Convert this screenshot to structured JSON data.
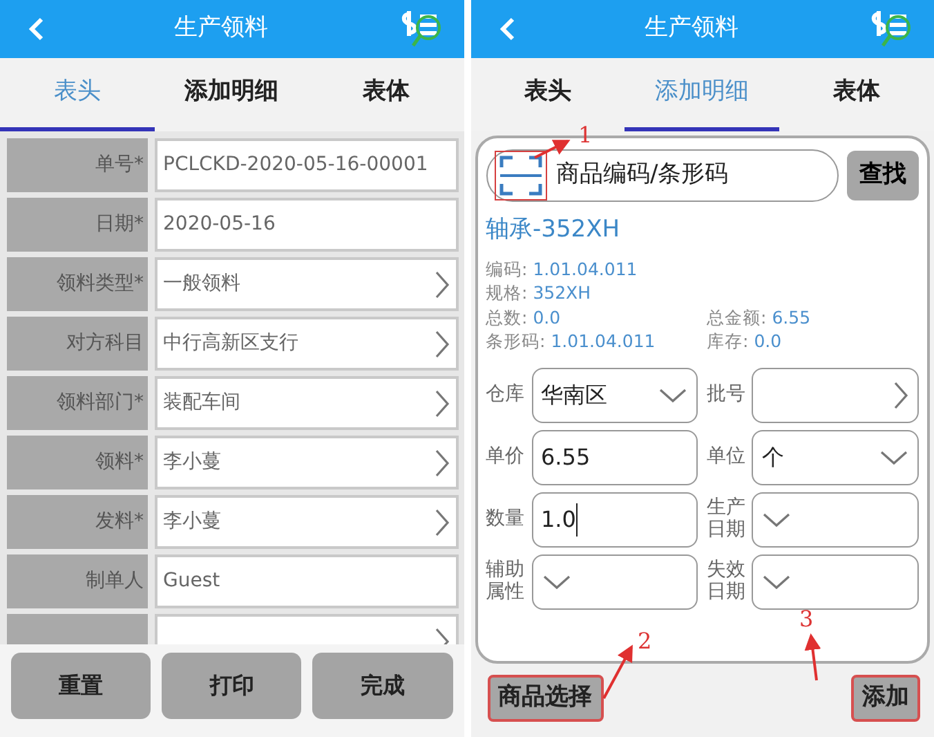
{
  "screens": [
    {
      "title": "生产领料",
      "tabs": [
        {
          "label": "表头",
          "selected": true
        },
        {
          "label": "添加明细",
          "selected": false
        },
        {
          "label": "表体",
          "selected": false
        }
      ],
      "fields": [
        {
          "label": "单号*",
          "value": "PCLCKD-2020-05-16-00001",
          "kind": "text"
        },
        {
          "label": "日期*",
          "value": "2020-05-16",
          "kind": "text"
        },
        {
          "label": "领料类型*",
          "value": "一般领料",
          "kind": "picker"
        },
        {
          "label": "对方科目",
          "value": "中行高新区支行",
          "kind": "picker"
        },
        {
          "label": "领料部门*",
          "value": "装配车间",
          "kind": "picker"
        },
        {
          "label": "领料*",
          "value": "李小蔓",
          "kind": "picker"
        },
        {
          "label": "发料*",
          "value": "李小蔓",
          "kind": "picker"
        },
        {
          "label": "制单人",
          "value": "Guest",
          "kind": "text"
        },
        {
          "kind": "picker"
        }
      ],
      "buttons": [
        "重置",
        "打印",
        "完成"
      ]
    },
    {
      "title": "生产领料",
      "tabs": [
        {
          "label": "表头",
          "selected": false
        },
        {
          "label": "添加明细",
          "selected": true
        },
        {
          "label": "表体",
          "selected": false
        }
      ],
      "search": {
        "placeholder": "商品编码/条形码",
        "button": "查找"
      },
      "product": {
        "name": "轴承-352XH",
        "spec_rows": [
          [
            {
              "label": "编码:",
              "value": "1.01.04.011"
            }
          ],
          [
            {
              "label": "规格:",
              "value": "352XH"
            }
          ],
          [
            {
              "label": "总数:",
              "value": "0.0"
            },
            {
              "label": "总金额:",
              "value": "6.55"
            }
          ],
          [
            {
              "label": "条形码:",
              "value": "1.01.04.011"
            },
            {
              "label": "库存:",
              "value": "0.0"
            }
          ]
        ]
      },
      "form": [
        [
          {
            "label": "仓库",
            "value": "华南区",
            "kind": "select"
          },
          {
            "label": "批号",
            "kind": "picker"
          }
        ],
        [
          {
            "label": "单价",
            "value": "6.55",
            "kind": "input",
            "focused": false
          },
          {
            "label": "单位",
            "value": "个",
            "kind": "select"
          }
        ],
        [
          {
            "label": "数量",
            "value": "1.0",
            "kind": "input",
            "focused": true
          },
          {
            "label": "生产日期",
            "kind": "select"
          }
        ],
        [
          {
            "label": "辅助属性",
            "kind": "select"
          },
          {
            "label": "失效日期",
            "kind": "select"
          }
        ]
      ],
      "buttons": [
        "商品选择",
        "添加"
      ],
      "annotations": [
        "1",
        "2",
        "3"
      ]
    }
  ]
}
